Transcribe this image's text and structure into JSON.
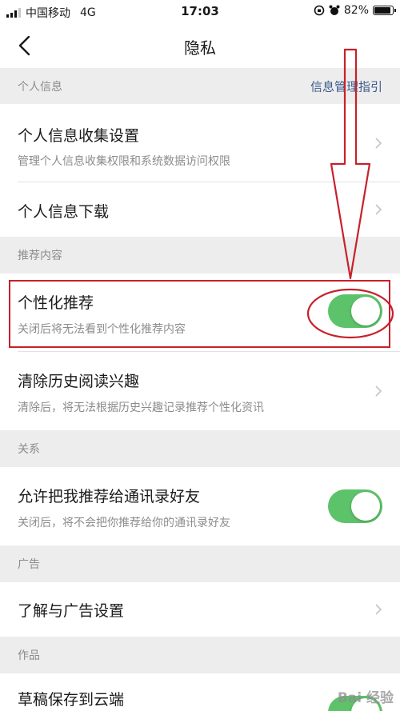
{
  "status_bar": {
    "carrier": "中国移动",
    "network": "4G",
    "time": "17:03",
    "battery": "82%"
  },
  "nav": {
    "title": "隐私"
  },
  "sections": {
    "personal_info": {
      "header": "个人信息",
      "link": "信息管理指引",
      "collect_title": "个人信息收集设置",
      "collect_desc": "管理个人信息收集权限和系统数据访问权限",
      "download_title": "个人信息下载"
    },
    "recommend": {
      "header": "推荐内容",
      "personalized_title": "个性化推荐",
      "personalized_desc": "关闭后将无法看到个性化推荐内容",
      "personalized_on": true,
      "clear_title": "清除历史阅读兴趣",
      "clear_desc": "清除后，将无法根据历史兴趣记录推荐个性化资讯"
    },
    "relation": {
      "header": "关系",
      "allow_title": "允许把我推荐给通讯录好友",
      "allow_desc": "关闭后，将不会把你推荐给你的通讯录好友",
      "allow_on": true
    },
    "ads": {
      "header": "广告",
      "ads_title": "了解与广告设置"
    },
    "works": {
      "header": "作品",
      "draft_title": "草稿保存到云端"
    }
  },
  "watermark": "Bai 经验",
  "colors": {
    "toggle_on": "#5cc36a",
    "annotation": "#c8202a",
    "link": "#3c5a8c"
  }
}
